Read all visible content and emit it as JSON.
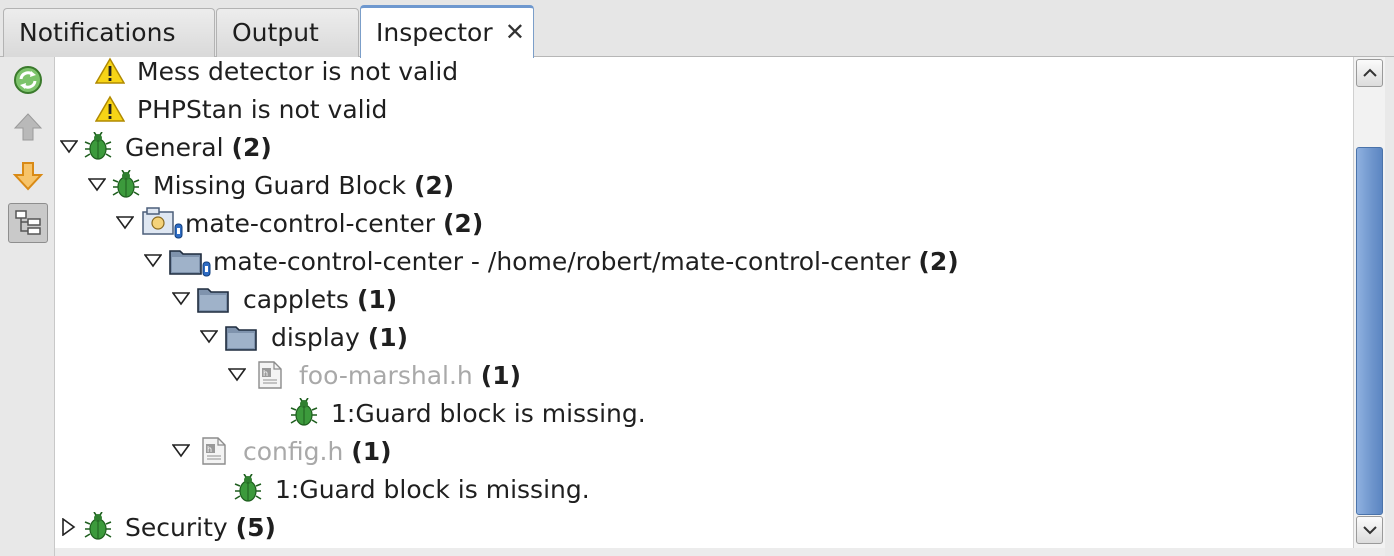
{
  "tabs": [
    {
      "label": "Notifications"
    },
    {
      "label": "Output"
    },
    {
      "label": "Inspector",
      "close": "✕"
    }
  ],
  "toolbar": {
    "refresh": "refresh-icon",
    "previous": "arrow-up-icon",
    "next": "arrow-down-icon",
    "tree_view": "tree-view-icon"
  },
  "tree": {
    "warnings": [
      {
        "label": "Mess detector is not valid"
      },
      {
        "label": "PHPStan is not valid"
      }
    ],
    "general": {
      "label": "General",
      "count": "(2)"
    },
    "missing_guard": {
      "label": "Missing Guard Block",
      "count": "(2)"
    },
    "project": {
      "label": "mate-control-center",
      "count": "(2)"
    },
    "source_root": {
      "label": "mate-control-center - /home/robert/mate-control-center",
      "count": "(2)"
    },
    "capplets": {
      "label": "capplets",
      "count": "(1)"
    },
    "display": {
      "label": "display",
      "count": "(1)"
    },
    "foo_marshal": {
      "label": "foo-marshal.h",
      "count": "(1)"
    },
    "foo_issue": {
      "label": "1:Guard block is missing."
    },
    "config": {
      "label": "config.h",
      "count": "(1)"
    },
    "config_issue": {
      "label": "1:Guard block is missing."
    },
    "security": {
      "label": "Security",
      "count": "(5)"
    }
  },
  "colors": {
    "accent": "#6e98cf",
    "bug": "#2f8f2f",
    "warning": "#f2c300",
    "dim_text": "#a9a9a9"
  }
}
